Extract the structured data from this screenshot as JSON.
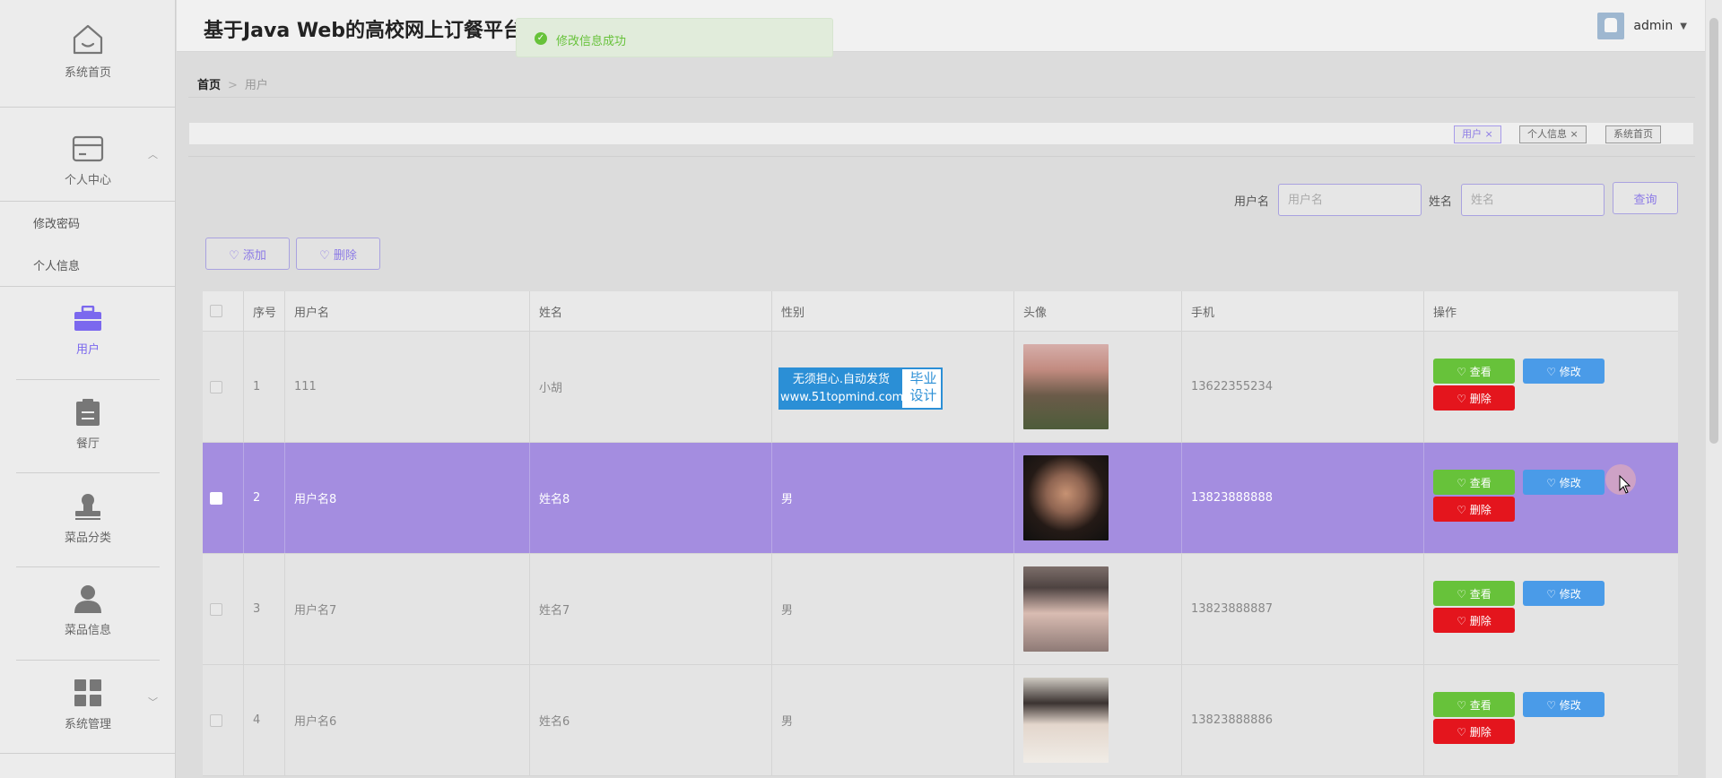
{
  "app": {
    "title": "基于Java Web的高校网上订餐平台设计与实现"
  },
  "toast": {
    "message": "修改信息成功"
  },
  "user": {
    "name": "admin"
  },
  "sidebar": {
    "home": "系统首页",
    "personal_center": "个人中心",
    "sub_change_password": "修改密码",
    "sub_personal_info": "个人信息",
    "users": "用户",
    "restaurant": "餐厅",
    "dish_category": "菜品分类",
    "dish_info": "菜品信息",
    "system_manage": "系统管理"
  },
  "breadcrumb": {
    "home": "首页",
    "separator": ">",
    "current": "用户"
  },
  "tags": [
    {
      "label": "用户 ×"
    },
    {
      "label": "个人信息 ×"
    },
    {
      "label": "系统首页"
    }
  ],
  "search": {
    "username_label": "用户名",
    "username_placeholder": "用户名",
    "name_label": "姓名",
    "name_placeholder": "姓名",
    "query_button": "查询"
  },
  "actions": {
    "add": "♡ 添加",
    "delete": "♡ 删除"
  },
  "table": {
    "headers": [
      "序号",
      "用户名",
      "姓名",
      "性别",
      "头像",
      "手机",
      "操作"
    ],
    "op_view": "♡ 查看",
    "op_edit": "♡ 修改",
    "op_delete": "♡ 删除",
    "rows": [
      {
        "index": "1",
        "username": "111",
        "name": "小胡",
        "gender": "",
        "phone": "13622355234"
      },
      {
        "index": "2",
        "username": "用户名8",
        "name": "姓名8",
        "gender": "男",
        "phone": "13823888888"
      },
      {
        "index": "3",
        "username": "用户名7",
        "name": "姓名7",
        "gender": "男",
        "phone": "13823888887"
      },
      {
        "index": "4",
        "username": "用户名6",
        "name": "姓名6",
        "gender": "男",
        "phone": "13823888886"
      }
    ]
  },
  "watermark": {
    "line1": "无须担心.自动发货",
    "line2": "www.51topmind.com",
    "right1": "毕业",
    "right2": "设计"
  },
  "colors": {
    "accent": "#8c7ae6",
    "selected_row": "#a48de0",
    "view": "#67c23a",
    "edit": "#4a9be8",
    "delete": "#e4151d",
    "toast_text": "#67c23a"
  }
}
